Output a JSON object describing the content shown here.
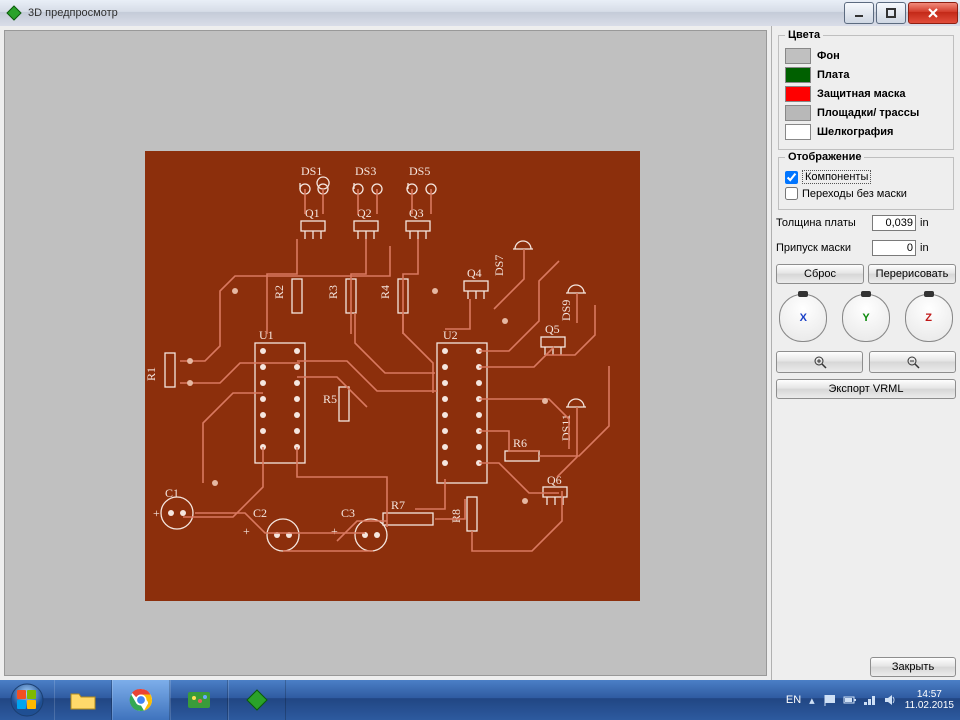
{
  "window": {
    "title": "3D предпросмотр"
  },
  "colors": {
    "legend": "Цвета",
    "rows": [
      {
        "label": "Фон",
        "hex": "#c0c0c0"
      },
      {
        "label": "Плата",
        "hex": "#006000"
      },
      {
        "label": "Защитная маска",
        "hex": "#ff0000"
      },
      {
        "label": "Площадки/ трассы",
        "hex": "#b8b8b8"
      },
      {
        "label": "Шелкография",
        "hex": "#ffffff"
      }
    ]
  },
  "display": {
    "legend": "Отображение",
    "components_label": "Компоненты",
    "components_on": true,
    "vias_label": "Переходы без маски",
    "vias_on": false
  },
  "thickness": {
    "label": "Толщина платы",
    "value": "0,039",
    "unit": "in"
  },
  "mask_allowance": {
    "label": "Припуск маски",
    "value": "0",
    "unit": "in"
  },
  "buttons": {
    "reset": "Сброс",
    "redraw": "Перерисовать",
    "export": "Экспорт VRML",
    "close": "Закрыть"
  },
  "axes": {
    "x": "X",
    "y": "Y",
    "z": "Z"
  },
  "taskbar": {
    "lang": "EN",
    "time": "14:57",
    "date": "11.02.2015"
  },
  "pcb": {
    "designators": [
      "DS1",
      "DS3",
      "DS5",
      "Q1",
      "Q2",
      "Q3",
      "Q4",
      "DS7",
      "R2",
      "R3",
      "R4",
      "DS9",
      "Q5",
      "U1",
      "U2",
      "R1",
      "R5",
      "DS11",
      "R6",
      "Q6",
      "C1",
      "C2",
      "C3",
      "R7",
      "R8"
    ]
  }
}
